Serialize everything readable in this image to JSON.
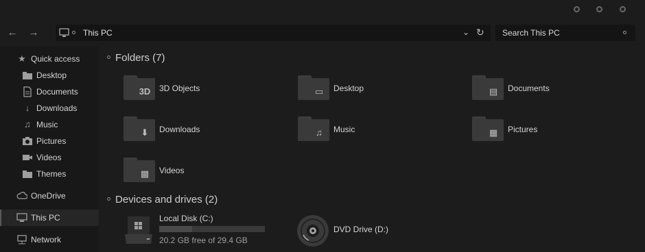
{
  "window": {
    "controls": [
      "minimize-icon",
      "maximize-icon",
      "close-icon"
    ]
  },
  "navigation": {
    "back_icon": "arrow-left-icon",
    "forward_icon": "arrow-right-icon"
  },
  "address_bar": {
    "location_icon": "computer-icon",
    "path": "This PC",
    "dropdown_icon": "chevron-down-icon",
    "refresh_icon": "refresh-icon"
  },
  "search": {
    "placeholder": "Search This PC",
    "icon": "search-icon"
  },
  "sidebar": {
    "quick_access": {
      "label": "Quick access",
      "icon": "star-icon"
    },
    "quick_items": [
      {
        "label": "Desktop",
        "icon": "folder-icon"
      },
      {
        "label": "Documents",
        "icon": "document-icon"
      },
      {
        "label": "Downloads",
        "icon": "download-icon"
      },
      {
        "label": "Music",
        "icon": "music-icon"
      },
      {
        "label": "Pictures",
        "icon": "camera-icon"
      },
      {
        "label": "Videos",
        "icon": "video-icon"
      },
      {
        "label": "Themes",
        "icon": "folder-icon"
      }
    ],
    "onedrive": {
      "label": "OneDrive",
      "icon": "cloud-icon"
    },
    "this_pc": {
      "label": "This PC",
      "icon": "computer-icon",
      "selected": true
    },
    "network": {
      "label": "Network",
      "icon": "network-icon"
    }
  },
  "folders_section": {
    "title": "Folders (7)",
    "items": [
      {
        "label": "3D Objects",
        "icon": "3d-objects-icon"
      },
      {
        "label": "Desktop",
        "icon": "desktop-icon"
      },
      {
        "label": "Documents",
        "icon": "document-icon"
      },
      {
        "label": "Downloads",
        "icon": "download-icon"
      },
      {
        "label": "Music",
        "icon": "music-icon"
      },
      {
        "label": "Pictures",
        "icon": "pictures-icon"
      },
      {
        "label": "Videos",
        "icon": "video-icon"
      }
    ]
  },
  "drives_section": {
    "title": "Devices and drives (2)",
    "drives": [
      {
        "label": "Local Disk (C:)",
        "icon": "hard-drive-icon",
        "free_text": "20.2 GB free of 29.4 GB",
        "used_fraction": 0.313
      },
      {
        "label": "DVD Drive (D:)",
        "icon": "dvd-drive-icon"
      }
    ]
  },
  "colors": {
    "background": "#1c1c1c",
    "sidebar": "#181818",
    "folder": "#3a3a3a",
    "text": "#d6d6d6"
  }
}
